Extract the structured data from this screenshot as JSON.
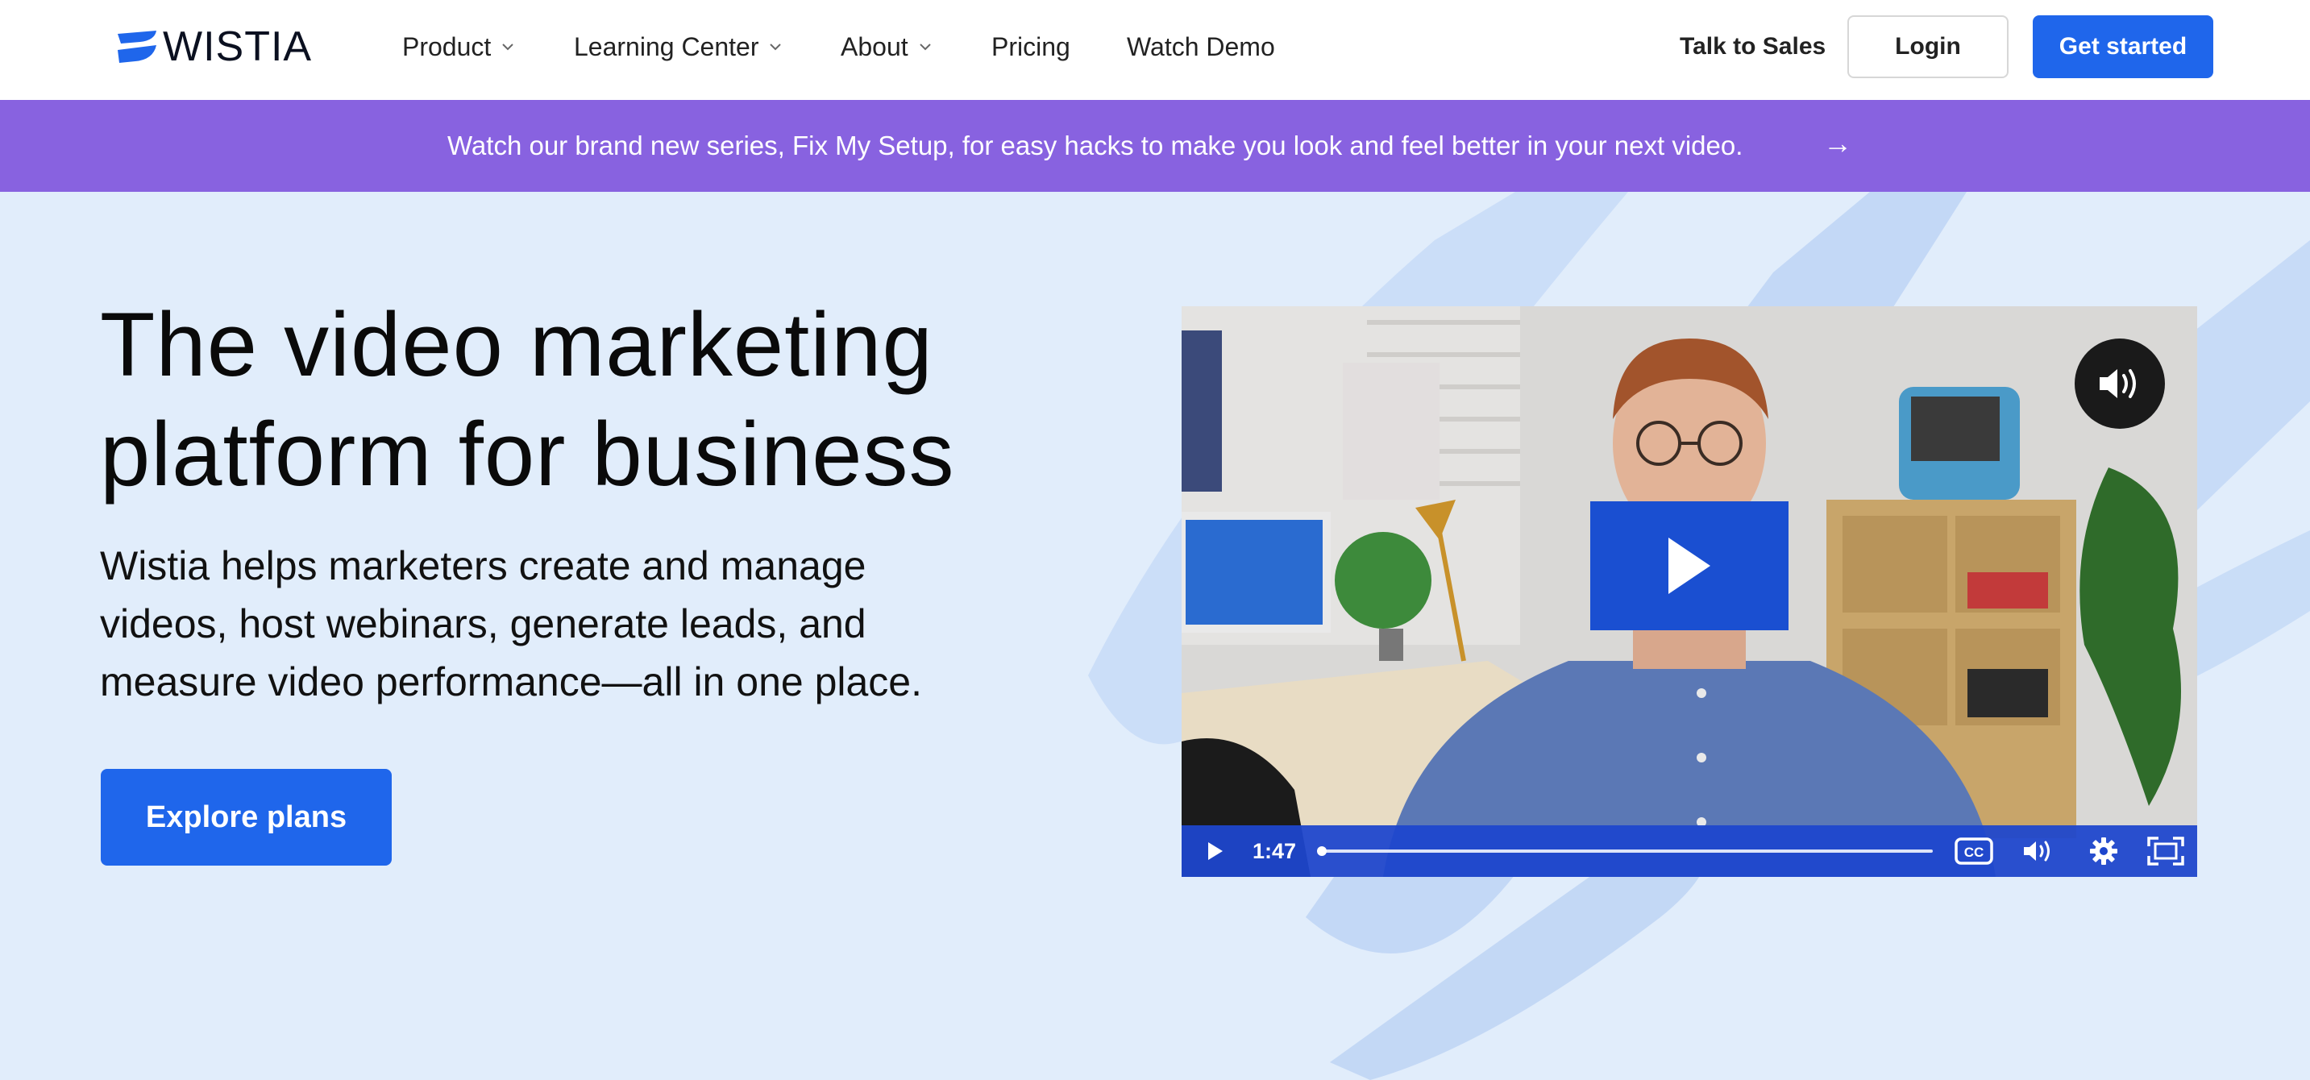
{
  "brand": {
    "name": "WISTIA"
  },
  "nav": {
    "items": [
      {
        "label": "Product",
        "has_dropdown": true
      },
      {
        "label": "Learning Center",
        "has_dropdown": true
      },
      {
        "label": "About",
        "has_dropdown": true
      },
      {
        "label": "Pricing",
        "has_dropdown": false
      },
      {
        "label": "Watch Demo",
        "has_dropdown": false
      }
    ],
    "talk_to_sales": "Talk to Sales",
    "login": "Login",
    "get_started": "Get started"
  },
  "banner": {
    "text": "Watch our brand new series, Fix My Setup, for easy hacks to make you look and feel better in your next video.",
    "arrow": "→"
  },
  "hero": {
    "headline_line1": "The video marketing",
    "headline_line2": "platform for business",
    "subcopy": "Wistia helps marketers create and manage videos, host webinars, generate leads, and measure video performance—all in one place.",
    "cta": "Explore plans"
  },
  "video": {
    "duration": "1:47",
    "progress_fraction": 0.0,
    "icons": [
      "mute-toggle-icon",
      "play-icon",
      "closed-captions-icon",
      "volume-icon",
      "settings-gear-icon",
      "fullscreen-icon"
    ]
  },
  "colors": {
    "primary_blue": "#1f66eb",
    "banner_purple": "#8862e0",
    "hero_bg": "#e1edfb",
    "video_controls": "#1e46cd"
  }
}
